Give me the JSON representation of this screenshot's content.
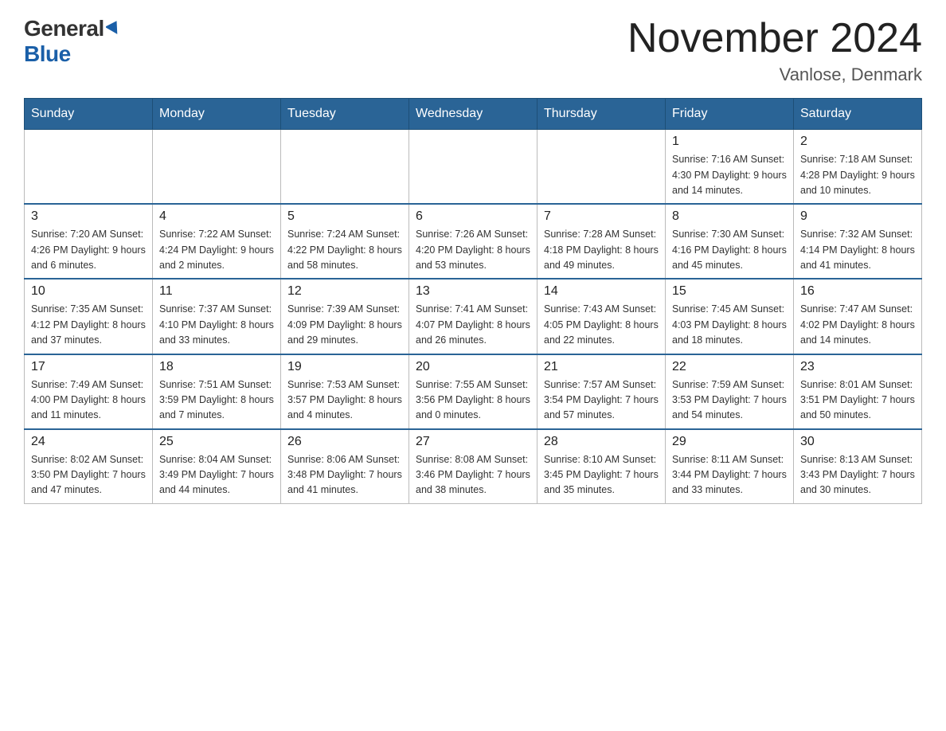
{
  "header": {
    "logo_general": "General",
    "logo_blue": "Blue",
    "title": "November 2024",
    "location": "Vanlose, Denmark"
  },
  "weekdays": [
    "Sunday",
    "Monday",
    "Tuesday",
    "Wednesday",
    "Thursday",
    "Friday",
    "Saturday"
  ],
  "weeks": [
    [
      {
        "day": "",
        "info": ""
      },
      {
        "day": "",
        "info": ""
      },
      {
        "day": "",
        "info": ""
      },
      {
        "day": "",
        "info": ""
      },
      {
        "day": "",
        "info": ""
      },
      {
        "day": "1",
        "info": "Sunrise: 7:16 AM\nSunset: 4:30 PM\nDaylight: 9 hours\nand 14 minutes."
      },
      {
        "day": "2",
        "info": "Sunrise: 7:18 AM\nSunset: 4:28 PM\nDaylight: 9 hours\nand 10 minutes."
      }
    ],
    [
      {
        "day": "3",
        "info": "Sunrise: 7:20 AM\nSunset: 4:26 PM\nDaylight: 9 hours\nand 6 minutes."
      },
      {
        "day": "4",
        "info": "Sunrise: 7:22 AM\nSunset: 4:24 PM\nDaylight: 9 hours\nand 2 minutes."
      },
      {
        "day": "5",
        "info": "Sunrise: 7:24 AM\nSunset: 4:22 PM\nDaylight: 8 hours\nand 58 minutes."
      },
      {
        "day": "6",
        "info": "Sunrise: 7:26 AM\nSunset: 4:20 PM\nDaylight: 8 hours\nand 53 minutes."
      },
      {
        "day": "7",
        "info": "Sunrise: 7:28 AM\nSunset: 4:18 PM\nDaylight: 8 hours\nand 49 minutes."
      },
      {
        "day": "8",
        "info": "Sunrise: 7:30 AM\nSunset: 4:16 PM\nDaylight: 8 hours\nand 45 minutes."
      },
      {
        "day": "9",
        "info": "Sunrise: 7:32 AM\nSunset: 4:14 PM\nDaylight: 8 hours\nand 41 minutes."
      }
    ],
    [
      {
        "day": "10",
        "info": "Sunrise: 7:35 AM\nSunset: 4:12 PM\nDaylight: 8 hours\nand 37 minutes."
      },
      {
        "day": "11",
        "info": "Sunrise: 7:37 AM\nSunset: 4:10 PM\nDaylight: 8 hours\nand 33 minutes."
      },
      {
        "day": "12",
        "info": "Sunrise: 7:39 AM\nSunset: 4:09 PM\nDaylight: 8 hours\nand 29 minutes."
      },
      {
        "day": "13",
        "info": "Sunrise: 7:41 AM\nSunset: 4:07 PM\nDaylight: 8 hours\nand 26 minutes."
      },
      {
        "day": "14",
        "info": "Sunrise: 7:43 AM\nSunset: 4:05 PM\nDaylight: 8 hours\nand 22 minutes."
      },
      {
        "day": "15",
        "info": "Sunrise: 7:45 AM\nSunset: 4:03 PM\nDaylight: 8 hours\nand 18 minutes."
      },
      {
        "day": "16",
        "info": "Sunrise: 7:47 AM\nSunset: 4:02 PM\nDaylight: 8 hours\nand 14 minutes."
      }
    ],
    [
      {
        "day": "17",
        "info": "Sunrise: 7:49 AM\nSunset: 4:00 PM\nDaylight: 8 hours\nand 11 minutes."
      },
      {
        "day": "18",
        "info": "Sunrise: 7:51 AM\nSunset: 3:59 PM\nDaylight: 8 hours\nand 7 minutes."
      },
      {
        "day": "19",
        "info": "Sunrise: 7:53 AM\nSunset: 3:57 PM\nDaylight: 8 hours\nand 4 minutes."
      },
      {
        "day": "20",
        "info": "Sunrise: 7:55 AM\nSunset: 3:56 PM\nDaylight: 8 hours\nand 0 minutes."
      },
      {
        "day": "21",
        "info": "Sunrise: 7:57 AM\nSunset: 3:54 PM\nDaylight: 7 hours\nand 57 minutes."
      },
      {
        "day": "22",
        "info": "Sunrise: 7:59 AM\nSunset: 3:53 PM\nDaylight: 7 hours\nand 54 minutes."
      },
      {
        "day": "23",
        "info": "Sunrise: 8:01 AM\nSunset: 3:51 PM\nDaylight: 7 hours\nand 50 minutes."
      }
    ],
    [
      {
        "day": "24",
        "info": "Sunrise: 8:02 AM\nSunset: 3:50 PM\nDaylight: 7 hours\nand 47 minutes."
      },
      {
        "day": "25",
        "info": "Sunrise: 8:04 AM\nSunset: 3:49 PM\nDaylight: 7 hours\nand 44 minutes."
      },
      {
        "day": "26",
        "info": "Sunrise: 8:06 AM\nSunset: 3:48 PM\nDaylight: 7 hours\nand 41 minutes."
      },
      {
        "day": "27",
        "info": "Sunrise: 8:08 AM\nSunset: 3:46 PM\nDaylight: 7 hours\nand 38 minutes."
      },
      {
        "day": "28",
        "info": "Sunrise: 8:10 AM\nSunset: 3:45 PM\nDaylight: 7 hours\nand 35 minutes."
      },
      {
        "day": "29",
        "info": "Sunrise: 8:11 AM\nSunset: 3:44 PM\nDaylight: 7 hours\nand 33 minutes."
      },
      {
        "day": "30",
        "info": "Sunrise: 8:13 AM\nSunset: 3:43 PM\nDaylight: 7 hours\nand 30 minutes."
      }
    ]
  ]
}
